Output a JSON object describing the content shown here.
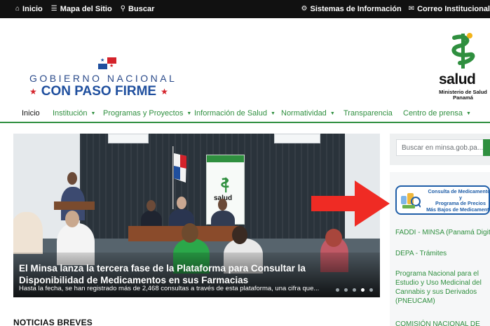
{
  "topbar": {
    "items_left": [
      {
        "icon": "home-icon",
        "glyph": "⌂",
        "label": "Inicio"
      },
      {
        "icon": "sitemap-icon",
        "glyph": "☰",
        "label": "Mapa del Sitio"
      },
      {
        "icon": "search-icon",
        "glyph": "⚲",
        "label": "Buscar"
      }
    ],
    "items_right": [
      {
        "icon": "gear-icon",
        "glyph": "⚙",
        "label": "Sistemas de Información"
      },
      {
        "icon": "mail-icon",
        "glyph": "✉",
        "label": "Correo Institucional"
      }
    ]
  },
  "header": {
    "gobierno_line1": "GOBIERNO NACIONAL",
    "gobierno_line2": "CON PASO FIRME",
    "salud_word": "salud",
    "salud_sub": "Ministerio de Salud\nPanamá"
  },
  "nav": {
    "items": [
      {
        "label": "Inicio",
        "caret": false,
        "active": true
      },
      {
        "label": "Institución",
        "caret": true,
        "active": false
      },
      {
        "label": "Programas y Proyectos",
        "caret": true,
        "active": false
      },
      {
        "label": "Información de Salud",
        "caret": true,
        "active": false
      },
      {
        "label": "Normatividad",
        "caret": true,
        "active": false
      },
      {
        "label": "Transparencia",
        "caret": false,
        "active": false
      },
      {
        "label": "Centro de prensa",
        "caret": true,
        "active": false
      }
    ]
  },
  "slider": {
    "title": "El Minsa lanza la tercera fase de la Plataforma para Consultar la Disponibilidad de Medicamentos en sus Farmacias",
    "subtitle": "Hasta la fecha, se han registrado más de 2,468 consultas a través de esta plataforma, una cifra que...",
    "banner_text": "salud",
    "dots": 5,
    "active_dot": 4
  },
  "sections": {
    "noticias_breves": "NOTICIAS BREVES"
  },
  "sidebar": {
    "search_placeholder": "Buscar en minsa.gob.pa...",
    "consulta_lines": [
      "Consulta de Medicamentos",
      "y",
      "Programa de Precios",
      "Más Bajos de Medicamentos"
    ],
    "links": [
      "FADDI - MINSA (Panamá Digital)",
      "DEPA - Trámites",
      "Programa Nacional para el Estudio y Uso Medicinal del Cannabis y sus Derivados (PNEUCAM)",
      "COMISIÓN NACIONAL DE"
    ]
  },
  "colors": {
    "green": "#2f8f3f",
    "blue": "#1f4f9e",
    "red": "#d4222a",
    "arrow_red": "#ef2b24"
  }
}
